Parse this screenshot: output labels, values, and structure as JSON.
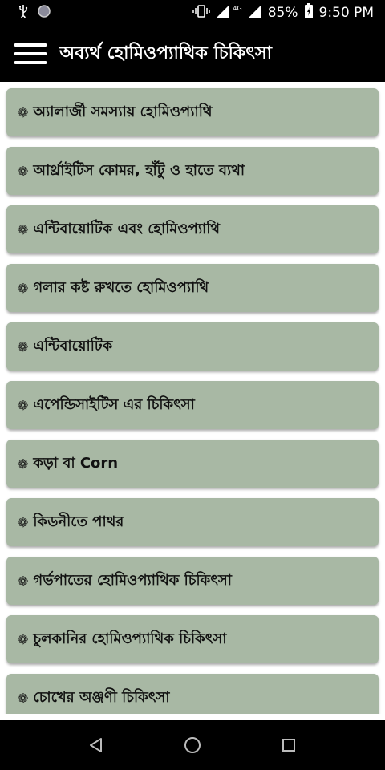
{
  "status_bar": {
    "battery_percent": "85%",
    "time": "9:50 PM",
    "network_label": "4G",
    "icons": [
      "usb-icon",
      "notification-dot-icon",
      "vibrate-icon",
      "signal-icon",
      "battery-icon"
    ]
  },
  "app_bar": {
    "title": "অব্যর্থ হোমিওপ্যাথিক চিকিৎসা",
    "menu_icon": "hamburger-menu-icon"
  },
  "list": {
    "bullet": "❁",
    "items": [
      {
        "label": "অ্যালার্জী সমস্যায় হোমিওপ্যাথি"
      },
      {
        "label": "আর্থ্রাইটিস কোমর, হাঁটু ও হাতে ব্যথা"
      },
      {
        "label": "এন্টিবায়োটিক এবং হোমিওপ্যাথি"
      },
      {
        "label": "গলার কষ্ট রুখতে হোমিওপ্যাথি"
      },
      {
        "label": "এন্টিবায়োটিক"
      },
      {
        "label": "এপেন্ডিসাইটিস এর চিকিৎসা"
      },
      {
        "label": "কড়া বা Corn"
      },
      {
        "label": "কিডনীতে পাথর"
      },
      {
        "label": "গর্ভপাতের হোমিওপ্যাথিক চিকিৎসা"
      },
      {
        "label": "চুলকানির হোমিওপ্যাথিক চিকিৎসা"
      },
      {
        "label": "চোখের অঞ্জণী চিকিৎসা"
      }
    ]
  },
  "nav_bar": {
    "icons": [
      "back-icon",
      "home-icon",
      "recents-icon"
    ]
  },
  "colors": {
    "card_bg": "#a8b8a4",
    "bar_bg": "#000000"
  }
}
